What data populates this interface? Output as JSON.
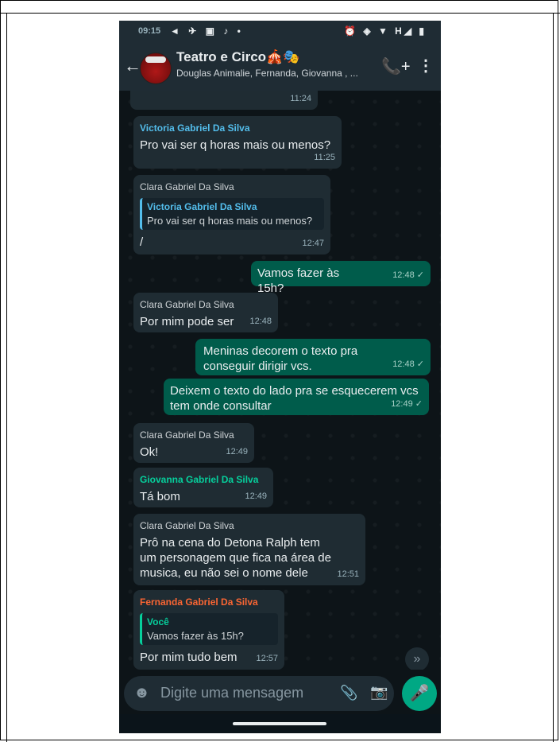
{
  "status_bar": {
    "time": "09:15",
    "left_icons": "◄ ✈ ▣ ♪ •",
    "right_icons": "⏰ ◈ ▼ H◢ ▮"
  },
  "header": {
    "back_icon": "←",
    "title": "Teatro e Circo🎪🎭",
    "subtitle": "Douglas Animalie, Fernanda, Giovanna , ...",
    "call_icon": "📞+",
    "menu_icon": "⋮"
  },
  "messages": [
    {
      "type": "in",
      "time": "11:24"
    },
    {
      "type": "in",
      "sender": "Victoria Gabriel Da Silva",
      "text": "Pro vai ser q horas mais ou menos?",
      "time": "11:25"
    },
    {
      "type": "in",
      "sender": "Clara Gabriel Da Silva",
      "quote_name": "Victoria Gabriel Da Silva",
      "quote_text": "Pro vai ser q horas mais ou menos?",
      "text": "/",
      "time": "12:47"
    },
    {
      "type": "out",
      "text": "Vamos fazer às 15h?",
      "time": "12:48 ✓"
    },
    {
      "type": "in",
      "sender": "Clara Gabriel Da Silva",
      "text": "Por mim pode ser",
      "time": "12:48"
    },
    {
      "type": "out",
      "text": "Meninas decorem o texto pra conseguir dirigir vcs.",
      "time": "12:48 ✓"
    },
    {
      "type": "out",
      "text": "Deixem o texto do lado pra se esquecerem vcs tem onde consultar",
      "time": "12:49 ✓"
    },
    {
      "type": "in",
      "sender": "Clara Gabriel Da Silva",
      "text": "Ok!",
      "time": "12:49"
    },
    {
      "type": "in",
      "sender": "Giovanna Gabriel Da Silva",
      "text": "Tá bom",
      "time": "12:49"
    },
    {
      "type": "in",
      "sender": "Clara Gabriel Da Silva",
      "text": "Prô na cena do Detona Ralph tem um personagem que fica na área de musica, eu não sei o nome dele",
      "time": "12:51"
    },
    {
      "type": "in",
      "sender": "Fernanda Gabriel Da Silva",
      "quote_name": "Você",
      "quote_text": "Vamos fazer às 15h?",
      "text": "Por mim tudo bem",
      "time": "12:57"
    }
  ],
  "input": {
    "placeholder": "Digite uma mensagem",
    "emoji_icon": "☻",
    "attach_icon": "📎",
    "camera_icon": "📷",
    "mic_icon": "🎤",
    "scroll_down_icon": "»"
  },
  "colors": {
    "incoming_bubble": "#1f2c33",
    "outgoing_bubble": "#005c4b",
    "accent": "#00a884"
  }
}
